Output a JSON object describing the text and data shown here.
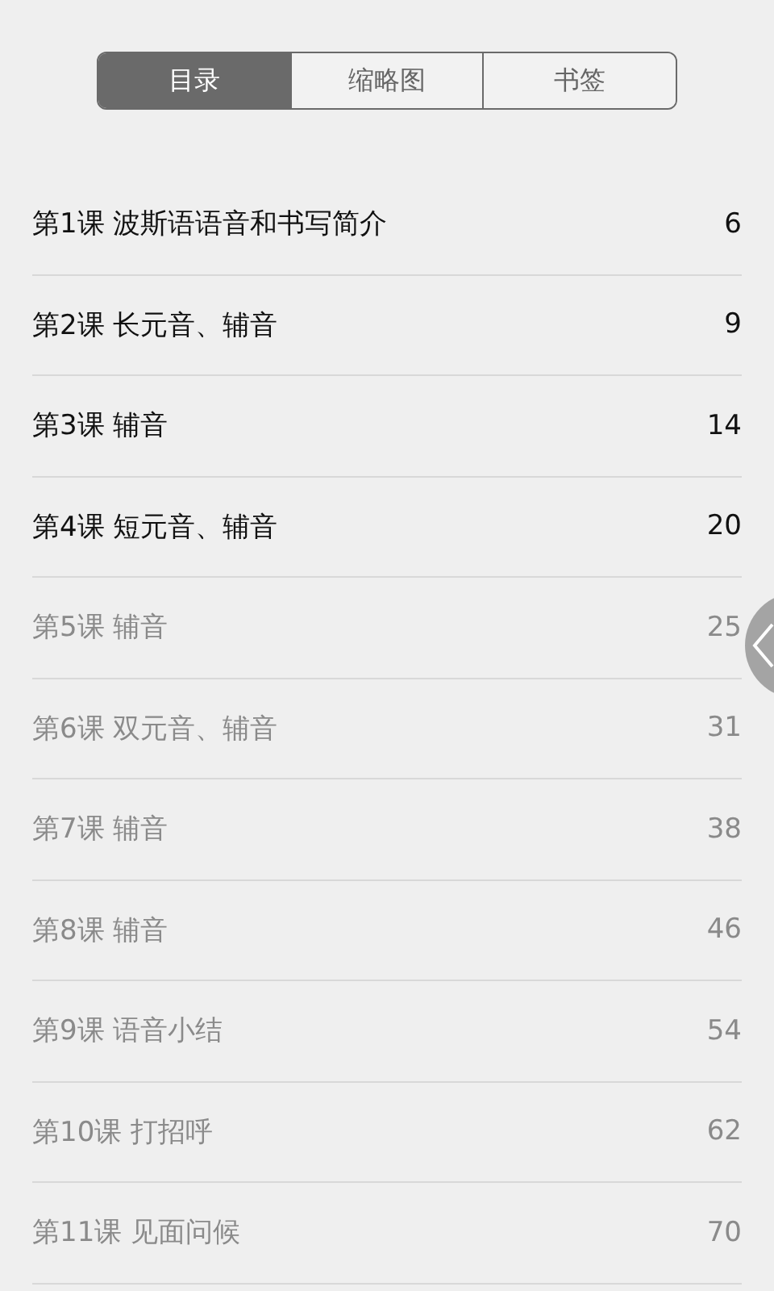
{
  "tabs": [
    {
      "label": "目录",
      "selected": true
    },
    {
      "label": "缩略图",
      "selected": false
    },
    {
      "label": "书签",
      "selected": false
    }
  ],
  "chapters": [
    {
      "title": "第1课 波斯语语音和书写简介",
      "page": "6",
      "dimmed": false
    },
    {
      "title": "第2课 长元音、辅音",
      "page": "9",
      "dimmed": false
    },
    {
      "title": "第3课 辅音",
      "page": "14",
      "dimmed": false
    },
    {
      "title": "第4课 短元音、辅音",
      "page": "20",
      "dimmed": false
    },
    {
      "title": "第5课 辅音",
      "page": "25",
      "dimmed": true
    },
    {
      "title": "第6课 双元音、辅音",
      "page": "31",
      "dimmed": true
    },
    {
      "title": "第7课 辅音",
      "page": "38",
      "dimmed": true
    },
    {
      "title": "第8课 辅音",
      "page": "46",
      "dimmed": true
    },
    {
      "title": "第9课 语音小结",
      "page": "54",
      "dimmed": true
    },
    {
      "title": "第10课 打招呼",
      "page": "62",
      "dimmed": true
    },
    {
      "title": "第11课 见面问候",
      "page": "70",
      "dimmed": true
    }
  ]
}
